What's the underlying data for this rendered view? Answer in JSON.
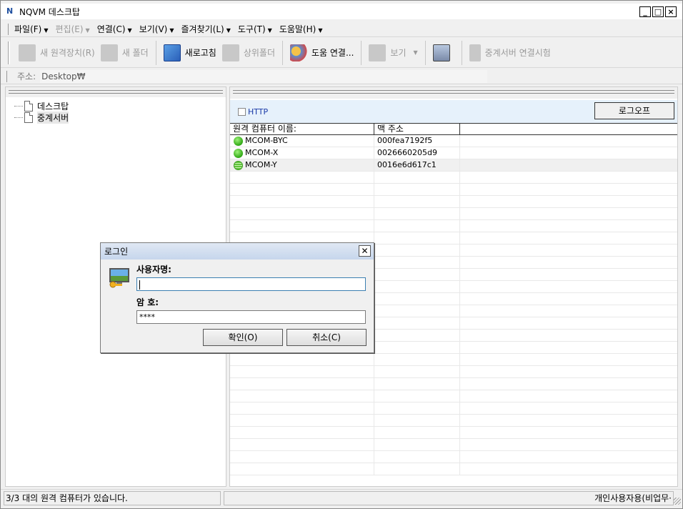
{
  "window": {
    "title": "NQVM 데스크탑",
    "btn_min": "_",
    "btn_max": "□",
    "btn_close": "×"
  },
  "menu": [
    {
      "label": "파일(F)",
      "disabled": false
    },
    {
      "label": "편집(E)",
      "disabled": true
    },
    {
      "label": "연결(C)",
      "disabled": false
    },
    {
      "label": "보기(V)",
      "disabled": false
    },
    {
      "label": "즐겨찾기(L)",
      "disabled": false
    },
    {
      "label": "도구(T)",
      "disabled": false
    },
    {
      "label": "도움말(H)",
      "disabled": false
    }
  ],
  "toolbar": {
    "new_remote": "새 원격장치(R)",
    "new_folder": "새 폴더",
    "refresh": "새로고침",
    "parent_folder": "상위폴더",
    "help_connect": "도움 연결...",
    "view": "보기",
    "relay_test": "중계서버 연결시험"
  },
  "address": {
    "label": "주소:",
    "value": "Desktop₩"
  },
  "tree": {
    "items": [
      "데스크탑",
      "중계서버"
    ]
  },
  "filter": {
    "http_label": "HTTP",
    "logoff_label": "로그오프"
  },
  "table": {
    "columns": [
      "원격 컴퓨터 이름:",
      "맥 주소"
    ],
    "rows": [
      {
        "name": "MCOM-BYC",
        "mac": "000fea7192f5",
        "status": "online"
      },
      {
        "name": "MCOM-X",
        "mac": "0026660205d9",
        "status": "online"
      },
      {
        "name": "MCOM-Y",
        "mac": "0016e6d617c1",
        "status": "connecting"
      }
    ]
  },
  "status": {
    "left": "3/3 대의 원격 컴퓨터가 있습니다.",
    "right": "개인사용자용(비업무·"
  },
  "dialog": {
    "title": "로그인",
    "username_label": "사용자명:",
    "username_value": "",
    "password_label": "암 호:",
    "password_value": "****",
    "ok_label": "확인(O)",
    "cancel_label": "취소(C)"
  }
}
